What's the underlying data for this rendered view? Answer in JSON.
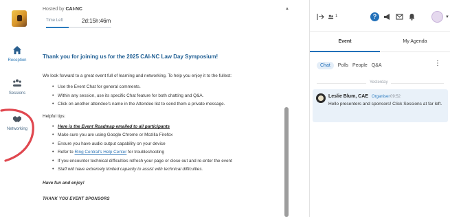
{
  "header": {
    "hosted_prefix": "Hosted by",
    "host_name": "CAI-NC",
    "time_left_label": "Time Left",
    "time_left_value": "2d:15h:46m",
    "time_left_progress_percent": 35
  },
  "rail": {
    "items": [
      {
        "label": "Reception",
        "icon": "home-icon"
      },
      {
        "label": "Sessions",
        "icon": "people-group-icon"
      },
      {
        "label": "Networking",
        "icon": "handshake-icon"
      }
    ]
  },
  "content": {
    "welcome": "Thank you for joining us for the 2025 CAI-NC Law Day Symposium!",
    "intro": "We look forward to a great event full of learning and networking. To help you enjoy it to the fullest:",
    "bullets": [
      "Use the Event Chat for general comments.",
      "Within any session, use its specific Chat feature for both chatting and Q&A.",
      "Click on another attendee's name in the Attendee list to send them a private message."
    ],
    "tips_heading": "Helpful tips:",
    "tips": {
      "roadmap": "Here is the Event Roadmap emailed to all participants",
      "browser": "Make sure you are using Google Chrome or Mozilla Firefox",
      "audio": "Ensure you have audio output capability on your device",
      "refer_prefix": "Refer to",
      "refer_link": "Ring Central's Help Center",
      "refer_suffix": "for troubleshooting",
      "refresh": "If you encounter technical difficulties refresh your page or close out and re-enter the event",
      "staff": "Staff will have extremely limited capacity to assist with technical difficulties."
    },
    "have_fun": "Have fun and enjoy!",
    "sponsors_heading": "THANK YOU EVENT SPONSORS"
  },
  "panel": {
    "attendee_count": "1",
    "tabs": {
      "event": "Event",
      "agenda": "My Agenda"
    },
    "subtabs": [
      "Chat",
      "Polls",
      "People",
      "Q&A"
    ],
    "day_label": "Yesterday",
    "message": {
      "author": "Leslie Blum, CAE",
      "role": "Organiser",
      "time": "09:52",
      "text": "Hello presenters and sponsors! Click Sessions at far left."
    }
  },
  "colors": {
    "accent": "#2270b9",
    "welcome_text": "#1f5e93",
    "annotation": "#e0474f",
    "message_bg": "#e9f1f9"
  }
}
